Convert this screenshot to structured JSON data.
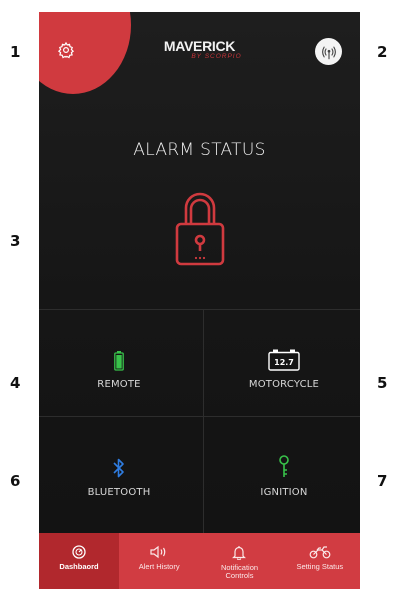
{
  "callouts": [
    "1",
    "2",
    "3",
    "4",
    "5",
    "6",
    "7"
  ],
  "header": {
    "logo_main": "MAVERICK",
    "logo_sub": "BY SCORPIO",
    "settings_icon": "gear-icon",
    "signal_icon": "antenna-icon"
  },
  "alarm": {
    "title": "ALARM STATUS",
    "icon": "padlock-icon",
    "color": "#d03a3f"
  },
  "status_grid": {
    "remote": {
      "label": "REMOTE",
      "icon": "battery-icon",
      "color": "#38c24a"
    },
    "motorcycle": {
      "label": "MOTORCYCLE",
      "icon": "car-battery-icon",
      "value": "12.7",
      "color": "#ffffff"
    },
    "bluetooth": {
      "label": "BLUETOOTH",
      "icon": "bluetooth-icon",
      "color": "#2f7de1"
    },
    "ignition": {
      "label": "IGNITION",
      "icon": "key-icon",
      "color": "#38c24a"
    }
  },
  "tabs": [
    {
      "label": "Dashbaord",
      "icon": "speedometer-icon",
      "active": true
    },
    {
      "label": "Alert History",
      "icon": "speaker-icon",
      "active": false
    },
    {
      "label": "Notification\nControls",
      "icon": "bell-icon",
      "active": false
    },
    {
      "label": "Setting Status",
      "icon": "motorcycle-icon",
      "active": false
    }
  ],
  "colors": {
    "accent": "#d13c42",
    "active_tab": "#b1282d",
    "background": "#161616"
  }
}
